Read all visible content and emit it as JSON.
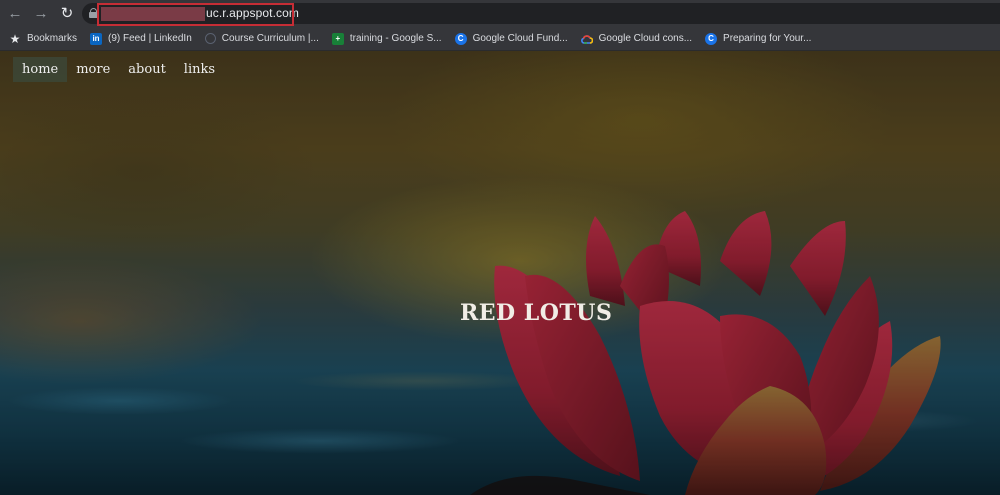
{
  "browser": {
    "back_icon": "arrow-left-icon",
    "forward_icon": "arrow-right-icon",
    "reload_icon": "reload-icon",
    "address_bar": {
      "url_visible": "uc.r.appspot.com"
    },
    "bookmarks": [
      {
        "label": "Bookmarks",
        "icon": "star-icon"
      },
      {
        "label": "(9) Feed | LinkedIn",
        "icon": "linkedin-icon"
      },
      {
        "label": "Course Curriculum |...",
        "icon": "course-icon"
      },
      {
        "label": "training - Google S...",
        "icon": "google-sheets-icon"
      },
      {
        "label": "Google Cloud Fund...",
        "icon": "coursera-icon"
      },
      {
        "label": "Google Cloud cons...",
        "icon": "google-cloud-icon"
      },
      {
        "label": "Preparing for Your...",
        "icon": "coursera-icon"
      }
    ]
  },
  "site": {
    "nav": [
      {
        "label": "home",
        "active": true
      },
      {
        "label": "more",
        "active": false
      },
      {
        "label": "about",
        "active": false
      },
      {
        "label": "links",
        "active": false
      }
    ],
    "hero_title": "RED LOTUS"
  },
  "colors": {
    "highlight_border": "#c62d35",
    "petal": "#b0263a"
  }
}
